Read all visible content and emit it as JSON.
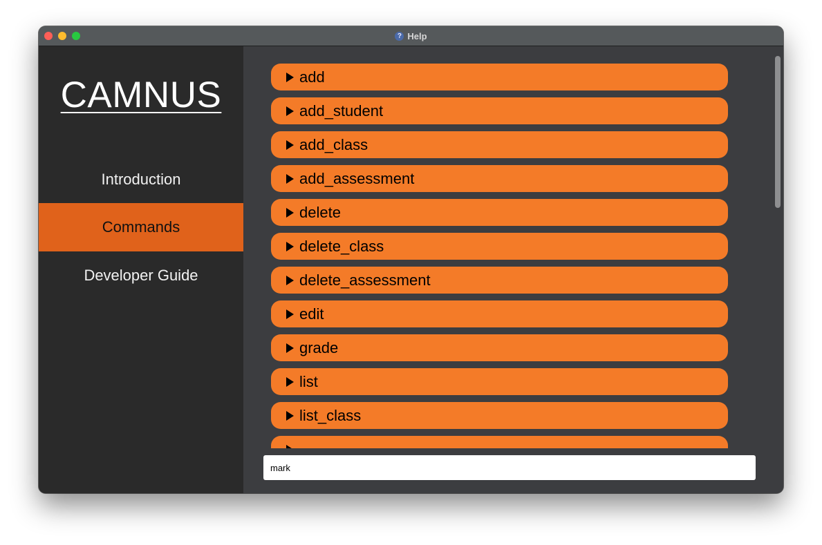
{
  "window": {
    "title": "Help",
    "title_icon": "help-icon"
  },
  "sidebar": {
    "logo": "CAMNUS",
    "items": [
      {
        "label": "Introduction",
        "active": false
      },
      {
        "label": "Commands",
        "active": true
      },
      {
        "label": "Developer Guide",
        "active": false
      }
    ]
  },
  "commands": [
    "add",
    "add_student",
    "add_class",
    "add_assessment",
    "delete",
    "delete_class",
    "delete_assessment",
    "edit",
    "grade",
    "list",
    "list_class",
    ""
  ],
  "search": {
    "value": "mark"
  },
  "colors": {
    "accent": "#f47b28",
    "active_nav": "#e0621b",
    "sidebar_bg": "#2a2a2a",
    "main_bg": "#3c3d40"
  }
}
